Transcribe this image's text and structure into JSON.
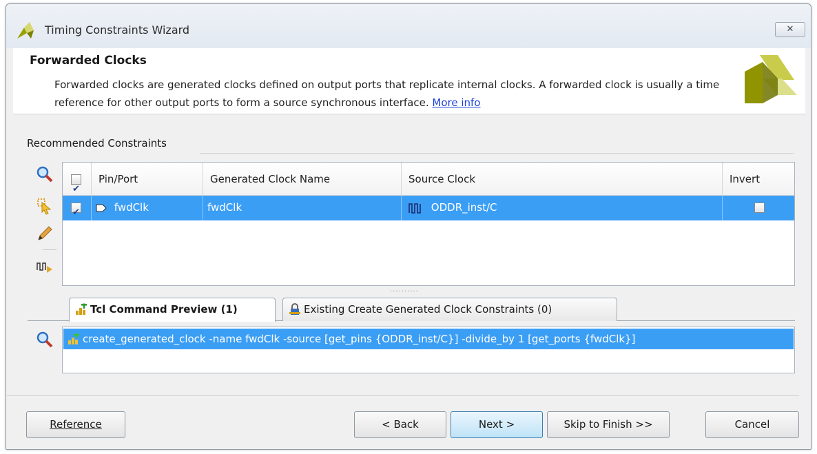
{
  "window": {
    "title": "Timing Constraints Wizard",
    "close_symbol": "✕"
  },
  "header": {
    "title": "Forwarded Clocks",
    "description": "Forwarded clocks are generated clocks defined on output ports that replicate internal clocks. A forwarded clock is usually a time reference for other output ports to form a source synchronous interface.",
    "link": "More info"
  },
  "recommended": {
    "label": "Recommended Constraints",
    "columns": [
      "Pin/Port",
      "Generated Clock Name",
      "Source Clock",
      "Invert"
    ],
    "rows": [
      {
        "checked": true,
        "pin_port": "fwdClk",
        "generated_clock_name": "fwdClk",
        "source_clock": "ODDR_inst/C",
        "invert": false
      }
    ],
    "toolbar_icons": [
      "search-icon",
      "select-cursor-icon",
      "edit-pencil-icon",
      "clock-waveform-icon"
    ],
    "splitter": "··········"
  },
  "tabs": [
    {
      "label": "Tcl Command Preview (1)",
      "active": true,
      "icon": "tcl-add-icon"
    },
    {
      "label": "Existing Create Generated Clock Constraints (0)",
      "active": false,
      "icon": "constraint-lock-icon"
    }
  ],
  "tcl_preview": {
    "commands": [
      "create_generated_clock -name fwdClk -source [get_pins {ODDR_inst/C}] -divide_by 1 [get_ports {fwdClk}]"
    ]
  },
  "buttons": {
    "reference": "Reference",
    "back": "< Back",
    "next": "Next >",
    "skip": "Skip to Finish >>",
    "cancel": "Cancel"
  },
  "colors": {
    "selection": "#3b9ef5",
    "link": "#1a3fd6",
    "logo_olive": "#8f9400",
    "logo_yellow": "#d4d66e"
  }
}
